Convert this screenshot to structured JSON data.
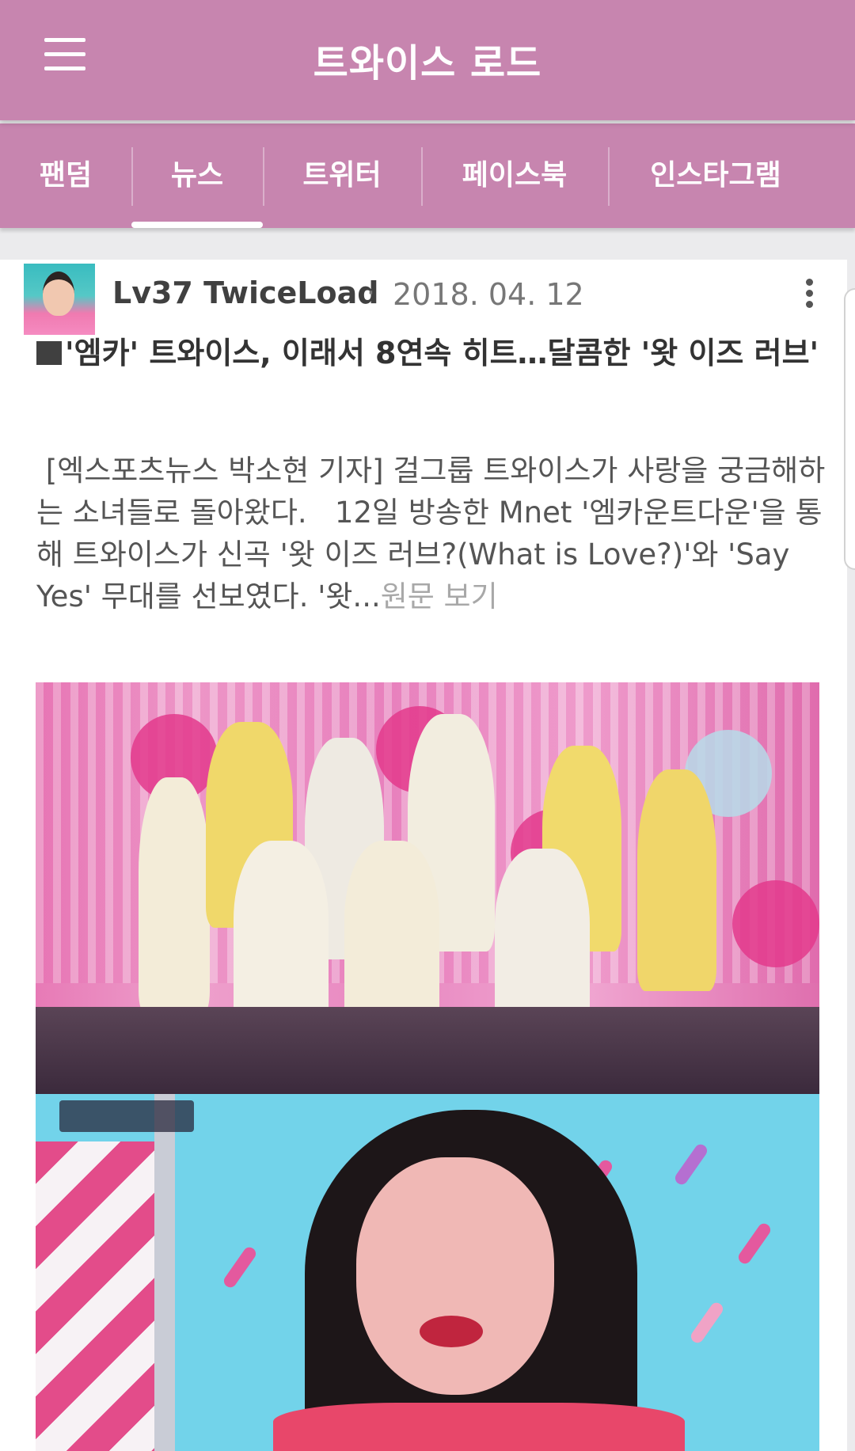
{
  "app_bar": {
    "title": "트와이스 로드",
    "menu_icon": "hamburger-menu-icon"
  },
  "tabs": [
    {
      "label": "팬덤",
      "selected": false
    },
    {
      "label": "뉴스",
      "selected": true
    },
    {
      "label": "트위터",
      "selected": false
    },
    {
      "label": "페이스북",
      "selected": false
    },
    {
      "label": "인스타그램",
      "selected": false
    }
  ],
  "post": {
    "author": "Lv37 TwiceLoad",
    "separator": "·",
    "date": "2018. 04. 12",
    "more_icon": "more-vertical-icon",
    "headline": "'엠카' 트와이스, 이래서 8연속 히트…달콤한 '왓 이즈 러브'",
    "summary": " [엑스포츠뉴스 박소현 기자] 걸그룹 트와이스가 사랑을 궁금해하는 소녀들로 돌아왔다.   12일 방송한 Mnet '엠카운트다운'을 통해 트와이스가 신곡 '왓 이즈 러브?(What is Love?)'와 'Say Yes' 무대를 선보였다. '왓...",
    "read_more": "원문 보기"
  },
  "colors": {
    "app_bar": "#c785af",
    "background": "#ebebed",
    "card": "#ffffff"
  }
}
